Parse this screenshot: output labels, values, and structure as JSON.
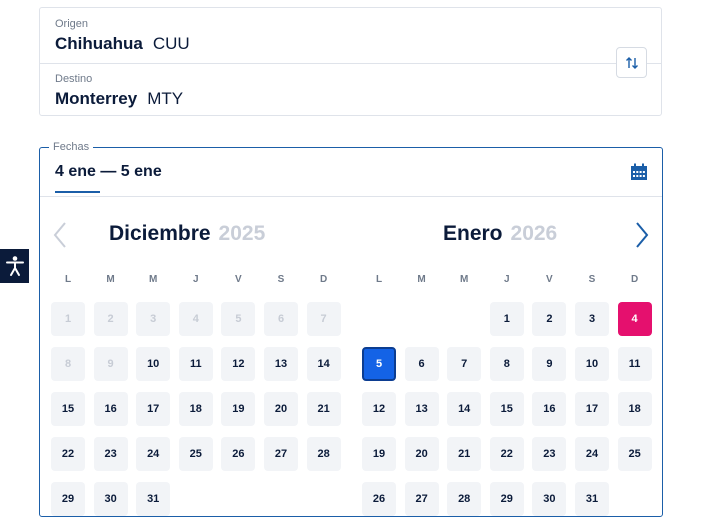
{
  "origin": {
    "label": "Origen",
    "city": "Chihuahua",
    "code": "CUU"
  },
  "destination": {
    "label": "Destino",
    "city": "Monterrey",
    "code": "MTY"
  },
  "swap": {
    "icon": "swap-vertical-icon"
  },
  "dates": {
    "legend": "Fechas",
    "value": "4 ene — 5 ene",
    "icon": "calendar-icon"
  },
  "weekdays": [
    "L",
    "M",
    "M",
    "J",
    "V",
    "S",
    "D"
  ],
  "calendar": {
    "left": {
      "month": "Diciembre",
      "year": "2025",
      "weeks": [
        [
          "1",
          "2",
          "3",
          "4",
          "5",
          "6",
          "7"
        ],
        [
          "8",
          "9",
          "10",
          "11",
          "12",
          "13",
          "14"
        ],
        [
          "15",
          "16",
          "17",
          "18",
          "19",
          "20",
          "21"
        ],
        [
          "22",
          "23",
          "24",
          "25",
          "26",
          "27",
          "28"
        ],
        [
          "29",
          "30",
          "31",
          "",
          "",
          "",
          ""
        ]
      ],
      "disabled_days": [
        "1",
        "2",
        "3",
        "4",
        "5",
        "6",
        "7",
        "8",
        "9"
      ]
    },
    "right": {
      "month": "Enero",
      "year": "2026",
      "weeks": [
        [
          "",
          "",
          "",
          "1",
          "2",
          "3",
          "4"
        ],
        [
          "5",
          "6",
          "7",
          "8",
          "9",
          "10",
          "11"
        ],
        [
          "12",
          "13",
          "14",
          "15",
          "16",
          "17",
          "18"
        ],
        [
          "19",
          "20",
          "21",
          "22",
          "23",
          "24",
          "25"
        ],
        [
          "26",
          "27",
          "28",
          "29",
          "30",
          "31",
          ""
        ]
      ],
      "disabled_days": []
    },
    "selection": {
      "start_day": "4",
      "end_day": "5",
      "start_color": "#e5106e",
      "end_color": "#1463e6"
    }
  },
  "nav": {
    "prev_icon": "chevron-left-icon",
    "next_icon": "chevron-right-icon"
  },
  "accessibility": {
    "icon": "accessibility-icon"
  },
  "colors": {
    "accent": "#1b5ea8",
    "text": "#0b1b3a",
    "muted": "#6f7a8a"
  }
}
